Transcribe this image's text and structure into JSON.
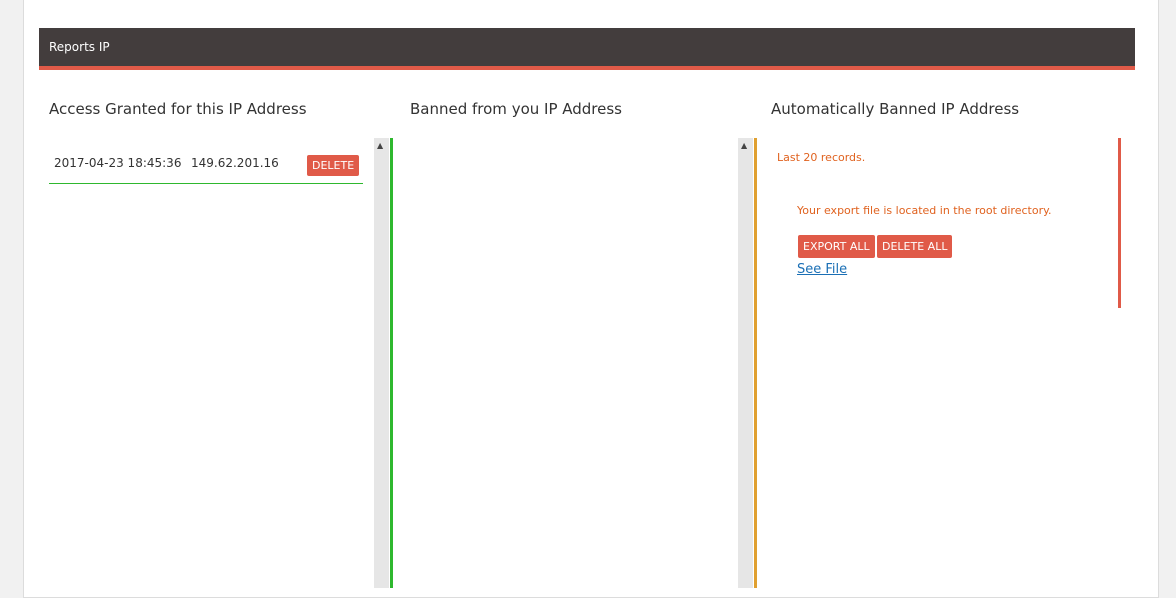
{
  "header": {
    "title": "Reports IP"
  },
  "columns": {
    "granted": {
      "title": "Access Granted for this IP Address"
    },
    "banned": {
      "title": "Banned from you IP Address"
    },
    "auto_banned": {
      "title": "Automatically Banned IP Address"
    }
  },
  "granted_rows": [
    {
      "date": "2017-04-23 18:45:36",
      "ip": "149.62.201.16",
      "delete_label": "DELETE"
    }
  ],
  "auto_panel": {
    "records_note": "Last 20 records.",
    "export_note": "Your export file is located in the root directory.",
    "export_all_label": "EXPORT ALL",
    "delete_all_label": "DELETE ALL",
    "see_file_label": "See File"
  },
  "scroll_icon": "▲",
  "colors": {
    "header_bg": "#433d3d",
    "accent": "#e05a48",
    "green": "#2eb82e",
    "orange": "#e0a030",
    "note_text": "#e0621f"
  }
}
